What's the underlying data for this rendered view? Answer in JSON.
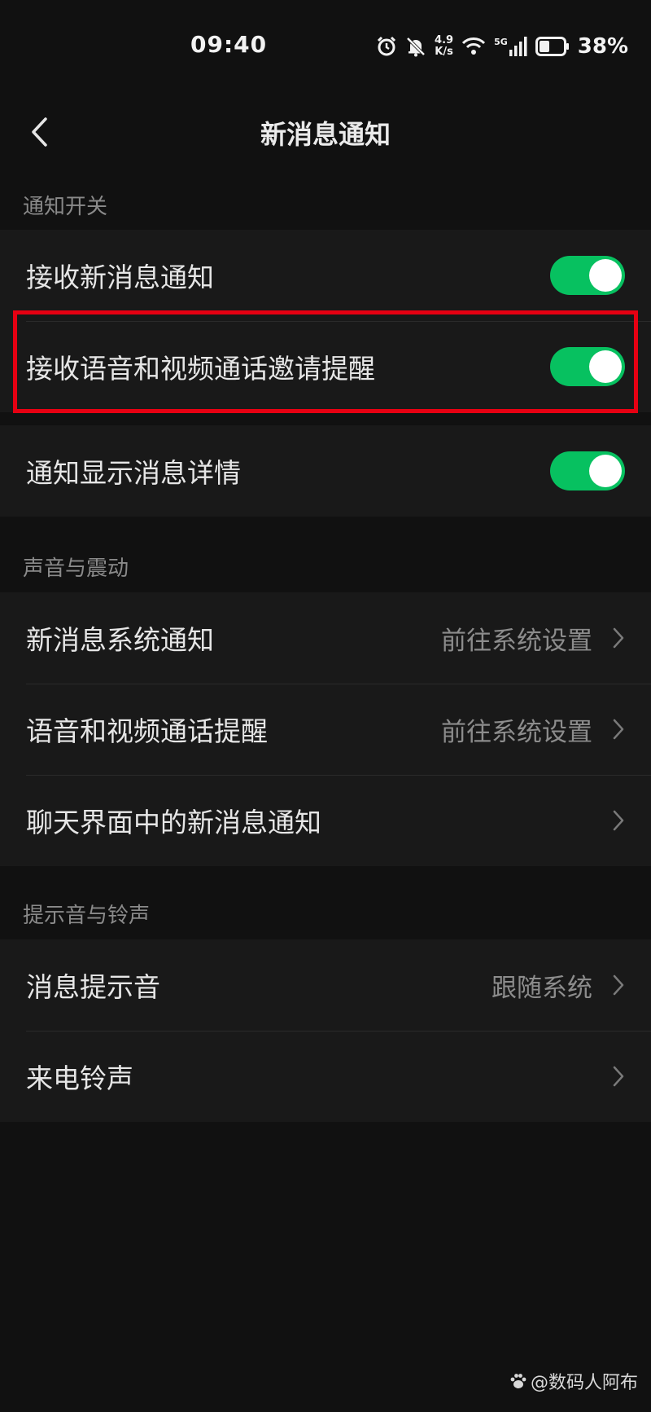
{
  "status_bar": {
    "time": "09:40",
    "speed_value": "4.9",
    "speed_unit": "K/s",
    "network": "5G",
    "battery_pct": "38%"
  },
  "nav": {
    "title": "新消息通知"
  },
  "sections": {
    "notify": {
      "header": "通知开关",
      "items": [
        {
          "label": "接收新消息通知",
          "on": true
        },
        {
          "label": "接收语音和视频通话邀请提醒",
          "on": true
        },
        {
          "label": "通知显示消息详情",
          "on": true
        }
      ]
    },
    "sound": {
      "header": "声音与震动",
      "items": [
        {
          "label": "新消息系统通知",
          "value": "前往系统设置"
        },
        {
          "label": "语音和视频通话提醒",
          "value": "前往系统设置"
        },
        {
          "label": "聊天界面中的新消息通知",
          "value": ""
        }
      ]
    },
    "tone": {
      "header": "提示音与铃声",
      "items": [
        {
          "label": "消息提示音",
          "value": "跟随系统"
        },
        {
          "label": "来电铃声",
          "value": ""
        }
      ]
    }
  },
  "watermark": {
    "text": "@数码人阿布"
  },
  "colors": {
    "toggle_on": "#07c160",
    "highlight": "#e60012",
    "background": "#111111",
    "row_background": "#191919"
  }
}
